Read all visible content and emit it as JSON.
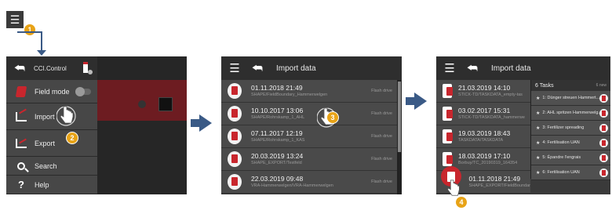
{
  "step_badges": [
    "1",
    "2",
    "3",
    "4"
  ],
  "colors": {
    "accent_red": "#c8262d",
    "badge_orange": "#e8a317",
    "arrow_blue": "#3a5a86"
  },
  "screen1": {
    "app_title": "CCI.Control",
    "menu": [
      {
        "icon": "field-mode-icon",
        "label": "Field mode"
      },
      {
        "icon": "import-icon",
        "label": "Import"
      },
      {
        "icon": "export-icon",
        "label": "Export"
      },
      {
        "icon": "search-icon",
        "label": "Search"
      },
      {
        "icon": "help-icon",
        "label": "Help"
      }
    ]
  },
  "screen2": {
    "title": "Import data",
    "rows": [
      {
        "date": "01.11.2018 21:49",
        "path": "SHAPE/FieldBoundary_Hammerwelgen",
        "source": "Flash drive"
      },
      {
        "date": "10.10.2017 13:06",
        "path": "SHAPE/Rohrskamp_1_AHL",
        "source": "Flash drive"
      },
      {
        "date": "07.11.2017 12:19",
        "path": "SHAPE/Rohrskamp_1_KAS",
        "source": "Flash drive"
      },
      {
        "date": "20.03.2019 13:24",
        "path": "SHAPE_EXPORT/Testfeld",
        "source": "Flash drive"
      },
      {
        "date": "22.03.2019 09:48",
        "path": "VRA-Hammerwelgen/VRA-Hammerwelgen",
        "source": "Flash drive"
      }
    ]
  },
  "screen3": {
    "title": "Import data",
    "rows": [
      {
        "date": "21.03.2019 14:10",
        "path": "STICK-TD/TASKDATA_empty-tas"
      },
      {
        "date": "03.02.2017 15:31",
        "path": "STICK-TD/TASKDATA_hammerwe"
      },
      {
        "date": "19.03.2019 18:43",
        "path": "TASKDATA/TASKDATA"
      },
      {
        "date": "18.03.2019 17:10",
        "path": "Borbuy/TC_20190319_164354"
      },
      {
        "date": "01.11.2018 21:49",
        "path": "SHAPE_EXPORT/FieldBoundar"
      }
    ],
    "tasks_header": "6 Tasks",
    "tasks_header_right": "6 new",
    "tasks": [
      "1: Dünger streuen Hammert...",
      "2: AHL spritzen Hammerwelg...",
      "3: Fertilizer spreading",
      "4: Fertilisation UAN",
      "5: Épandre l'engrais",
      "6: Fertilisation UAN"
    ]
  }
}
